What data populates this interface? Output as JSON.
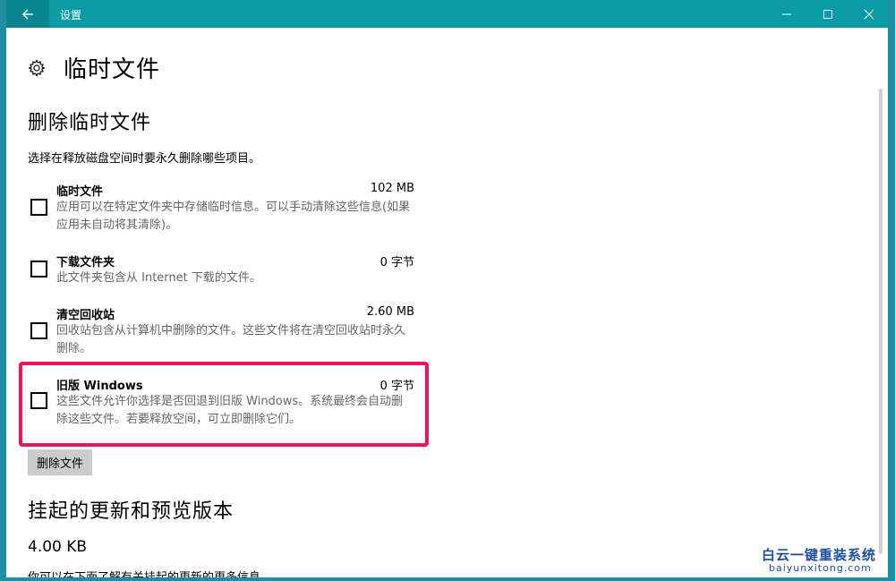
{
  "window": {
    "title": "设置",
    "back_icon": "back-arrow-icon",
    "minimize_icon": "minimize-icon",
    "maximize_icon": "maximize-icon",
    "close_icon": "close-icon"
  },
  "page": {
    "icon": "gear-icon",
    "title": "临时文件"
  },
  "delete_section": {
    "title": "删除临时文件",
    "description": "选择在释放磁盘空间时要永久删除哪些项目。",
    "items": [
      {
        "name": "临时文件",
        "size": "102 MB",
        "desc": "应用可以在特定文件夹中存储临时信息。可以手动清除这些信息(如果应用未自动将其清除)。",
        "checked": false
      },
      {
        "name": "下载文件夹",
        "size": "0 字节",
        "desc": "此文件夹包含从 Internet 下载的文件。",
        "checked": false
      },
      {
        "name": "清空回收站",
        "size": "2.60 MB",
        "desc": "回收站包含从计算机中删除的文件。这些文件将在清空回收站时永久删除。",
        "checked": false
      },
      {
        "name": "旧版 Windows",
        "size": "0 字节",
        "desc": "这些文件允许你选择是否回退到旧版 Windows。系统最终会自动删除这些文件。若要释放空间，可立即删除它们。",
        "checked": false
      }
    ],
    "delete_button": "删除文件"
  },
  "pending_section": {
    "title": "挂起的更新和预览版本",
    "size": "4.00 KB",
    "cut_text": "你可以在下面了解有关挂起的更新的更多信息"
  },
  "watermark": {
    "name": "白云一键重装系统",
    "url": "baiyunxitong.com"
  },
  "colors": {
    "titlebar": "#0b9ba7",
    "highlight": "#e8175d",
    "button": "#cccccc"
  }
}
